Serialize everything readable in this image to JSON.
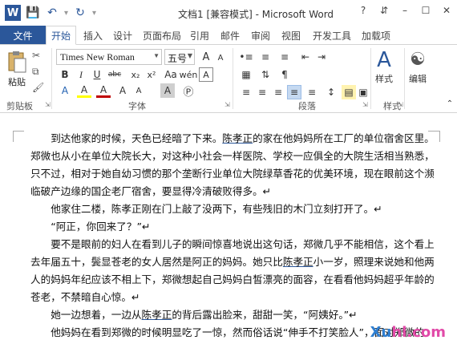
{
  "titlebar": {
    "title": "文档1 [兼容模式] - Microsoft Word",
    "logo": "W",
    "qat_icons": [
      "save-icon",
      "undo-icon",
      "redo-icon",
      "customize-icon"
    ],
    "help": "?",
    "controls": [
      "ribbon-display-icon",
      "minimize-icon",
      "maximize-icon",
      "close-icon"
    ]
  },
  "tabs": {
    "file": "文件",
    "items": [
      "开始",
      "插入",
      "设计",
      "页面布局",
      "引用",
      "邮件",
      "审阅",
      "视图",
      "开发工具",
      "加载项"
    ],
    "active": "开始"
  },
  "ribbon": {
    "clipboard": {
      "paste": "粘贴",
      "label": "剪贴板"
    },
    "font": {
      "name": "Times New Roman",
      "size": "五号",
      "label": "字体",
      "row1": [
        "A",
        "A",
        "Aa",
        "wén",
        "A"
      ],
      "row2": [
        "B",
        "I",
        "U",
        "abc",
        "x₂",
        "x²"
      ],
      "row3": [
        "A",
        "A",
        "A",
        "A",
        "A",
        "A"
      ]
    },
    "paragraph": {
      "label": "段落"
    },
    "styles": {
      "button": "样式",
      "label": "样式"
    },
    "editing": {
      "button": "编辑"
    }
  },
  "document": {
    "lines": [
      {
        "text": "　　到达他家的时候，天色已经暗了下来。陈孝正的家在他妈妈所在工厂的单位宿舍区里。",
        "ul": "陈孝正"
      },
      {
        "text": "郑微也从小在单位大院长大，对这种小社会一样医院、学校一应俱全的大院生活相当熟悉，",
        "ul": ""
      },
      {
        "text": "只不过，相对于她自幼习惯的那个垄断行业单位大院绿草香花的优美环境，现在眼前这个濒",
        "ul": ""
      },
      {
        "text": "临破产边缘的国企老厂宿舍，要显得冷清破败得多。↵",
        "ul": ""
      },
      {
        "text": "　　他家住二楼，陈孝正刚在门上敲了没两下，有些残旧的木门立刻打开了。↵",
        "ul": ""
      },
      {
        "text": "　　“阿正，你回来了？”↵",
        "ul": ""
      },
      {
        "text": "　　要不是眼前的妇人在看到儿子的瞬间惊喜地说出这句话，郑微几乎不能相信，这个看上",
        "ul": ""
      },
      {
        "text": "去年届五十，鬓显苍老的女人居然是阿正的妈妈。她只比陈孝正小一岁，照理来说她和他两",
        "ul": "陈孝正"
      },
      {
        "text": "人的妈妈年纪应该不相上下，郑微想起自己妈妈白皙漂亮的面容，在看看他妈妈超乎年龄的",
        "ul": ""
      },
      {
        "text": "苍老，不禁暗自心惊。↵",
        "ul": ""
      },
      {
        "text": "　　她一边想着，一边从陈孝正的背后露出脸来，甜甜一笑，“阿姨好。”↵",
        "ul": "陈孝正"
      },
      {
        "text": "　　他妈妈在看到郑微的时候明显吃了一惊，然而俗话说“伸手不打笑脸人”，面对郑微的",
        "ul": ""
      }
    ]
  },
  "watermark": {
    "part1": "Xu",
    "part2": "hl.com"
  },
  "colors": {
    "accent": "#2b579a",
    "watermark": "#e14aa8"
  }
}
